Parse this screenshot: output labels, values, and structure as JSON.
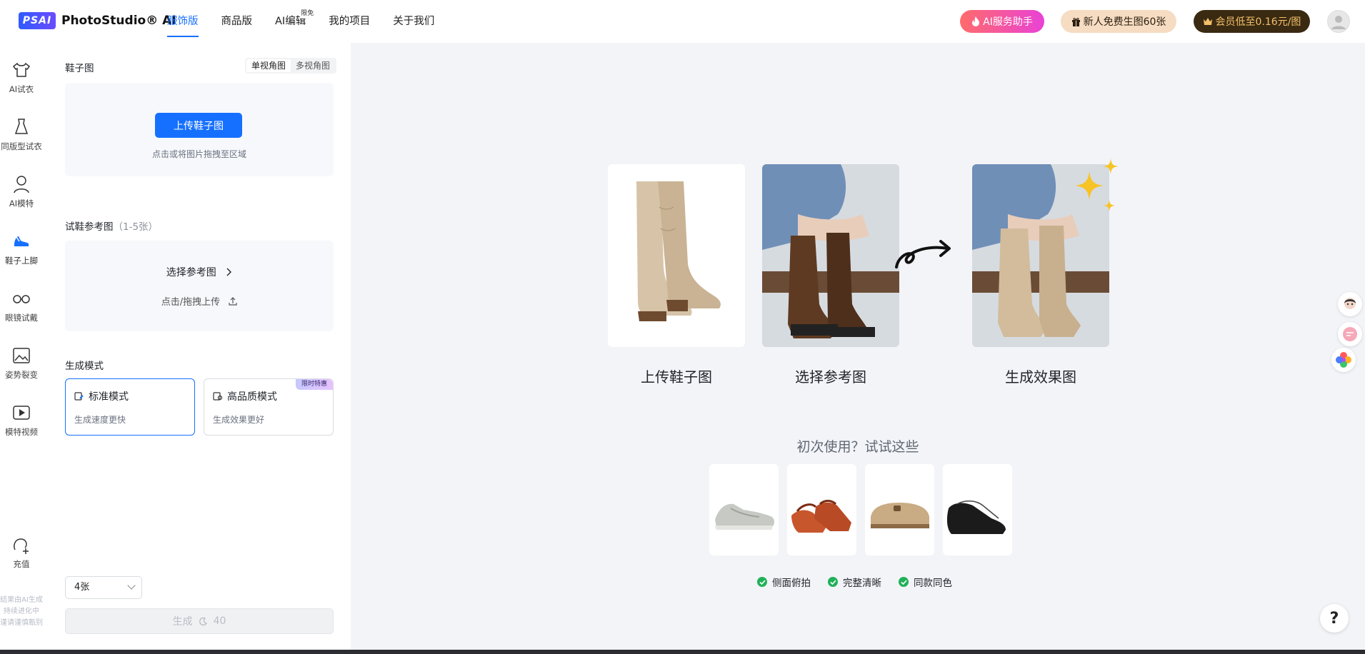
{
  "brand": {
    "mark": "PSAI",
    "name": "PhotoStudio® AI"
  },
  "nav": [
    {
      "label": "服饰版",
      "active": true
    },
    {
      "label": "商品版",
      "active": false
    },
    {
      "label": "AI编辑",
      "active": false,
      "badge": "限免"
    },
    {
      "label": "我的项目",
      "active": false
    },
    {
      "label": "关于我们",
      "active": false
    }
  ],
  "header_actions": {
    "ai_assistant": "AI服务助手",
    "new_user": "新人免费生图60张",
    "vip": "会员低至0.16元/图"
  },
  "rail": {
    "items": [
      {
        "label": "AI试衣",
        "icon": "shirt-icon"
      },
      {
        "label": "同版型试衣",
        "icon": "dress-icon"
      },
      {
        "label": "AI模特",
        "icon": "model-icon"
      },
      {
        "label": "鞋子上脚",
        "icon": "shoe-icon",
        "active": true
      },
      {
        "label": "眼镜试戴",
        "icon": "glasses-icon"
      },
      {
        "label": "姿势裂变",
        "icon": "pose-icon"
      },
      {
        "label": "模特视频",
        "icon": "video-icon"
      }
    ],
    "recharge": "充值",
    "note_lines": [
      "结果由AI生成",
      "持续进化中",
      "谨请谨慎甄别"
    ]
  },
  "panel": {
    "shoe_title": "鞋子图",
    "view_tabs": [
      "单视角图",
      "多视角图"
    ],
    "upload_button": "上传鞋子图",
    "upload_hint": "点击或将图片拖拽至区域",
    "ref_title": "试鞋参考图",
    "ref_count": "（1-5张）",
    "ref_choose": "选择参考图",
    "ref_upload": "点击/拖拽上传",
    "mode_title": "生成模式",
    "modes": [
      {
        "title": "标准模式",
        "sub": "生成速度更快",
        "selected": true
      },
      {
        "title": "高品质模式",
        "sub": "生成效果更好",
        "tag": "限时特惠"
      }
    ],
    "quantity": "4张",
    "generate_label": "生成",
    "generate_cost": "40"
  },
  "main": {
    "steps": [
      "上传鞋子图",
      "选择参考图",
      "生成效果图"
    ],
    "try_title": "初次使用？试试这些",
    "samples": [
      "sneaker",
      "red-flat",
      "clog",
      "oxford"
    ],
    "tips": [
      "侧面俯拍",
      "完整清晰",
      "同款同色"
    ],
    "help": "?"
  },
  "colors": {
    "accent": "#1670ff",
    "canvas": "#f3f4f8",
    "ok": "#21b05a"
  }
}
